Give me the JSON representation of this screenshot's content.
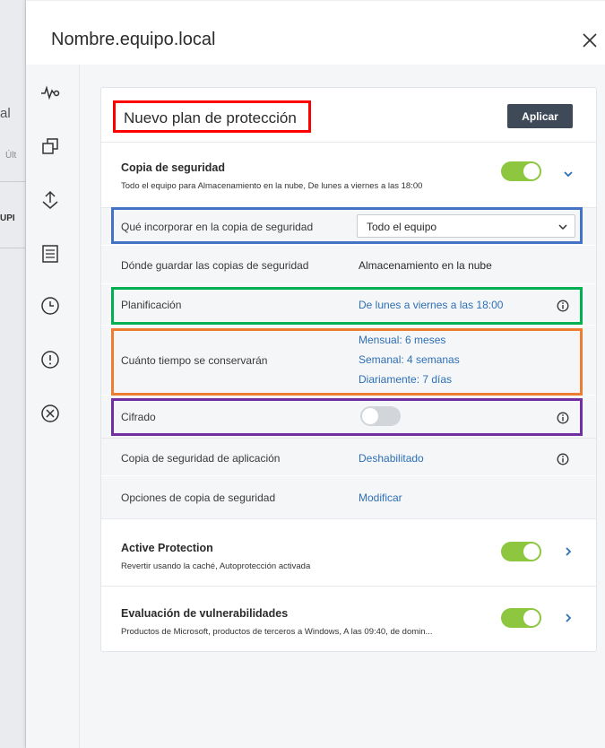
{
  "background": {
    "fragment_1": "al",
    "fragment_2": "Últ",
    "fragment_3": "UPI"
  },
  "header": {
    "title": "Nombre.equipo.local",
    "close_icon": "close-icon"
  },
  "sidebar": {
    "items": [
      {
        "icon": "activity-icon"
      },
      {
        "icon": "devices-icon"
      },
      {
        "icon": "protection-icon"
      },
      {
        "icon": "report-icon"
      },
      {
        "icon": "history-icon"
      },
      {
        "icon": "alert-icon"
      },
      {
        "icon": "cancel-icon"
      }
    ]
  },
  "plan": {
    "name": "Nuevo plan de protección",
    "apply_label": "Aplicar"
  },
  "backup": {
    "title": "Copia de seguridad",
    "subtitle": "Todo el equipo para Almacenamiento en la nube, De lunes a viernes a las 18:00",
    "enabled": true,
    "rows": {
      "what_label": "Qué incorporar en la copia de seguridad",
      "what_value": "Todo el equipo",
      "where_label": "Dónde guardar las copias de seguridad",
      "where_value": "Almacenamiento en la nube",
      "schedule_label": "Planificación",
      "schedule_value": "De lunes a viernes a las 18:00",
      "retention_label": "Cuánto tiempo se conservarán",
      "retention_monthly": "Mensual: 6 meses",
      "retention_weekly": "Semanal: 4 semanas",
      "retention_daily": "Diariamente: 7 días",
      "encryption_label": "Cifrado",
      "encryption_enabled": false,
      "app_backup_label": "Copia de seguridad de aplicación",
      "app_backup_value": "Deshabilitado",
      "options_label": "Opciones de copia de seguridad",
      "options_value": "Modificar"
    }
  },
  "active_protection": {
    "title": "Active Protection",
    "subtitle": "Revertir usando la caché, Autoprotección activada",
    "enabled": true
  },
  "vulnerability": {
    "title": "Evaluación de vulnerabilidades",
    "subtitle": "Productos de Microsoft, productos de terceros a Windows, A las 09:40, de domin...",
    "enabled": true
  },
  "colors": {
    "accent_green": "#8dc63f",
    "link_blue": "#2e6fb5",
    "apply_button": "#3f4a58",
    "highlight_red": "#ff0000",
    "highlight_blue": "#4472c4",
    "highlight_green": "#00b050",
    "highlight_orange": "#ed7d31",
    "highlight_purple": "#7030a0"
  }
}
